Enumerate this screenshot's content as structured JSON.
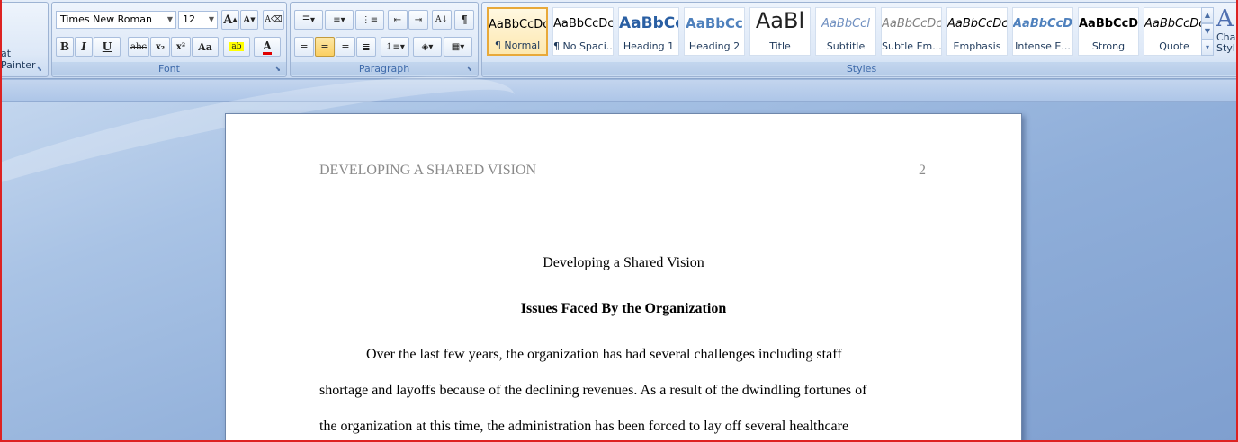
{
  "clipboard": {
    "format_painter_label": "at Painter"
  },
  "font": {
    "family": "Times New Roman",
    "size": "12",
    "group_label": "Font",
    "buttons": {
      "grow": "A",
      "shrink": "A",
      "bold": "B",
      "italic": "I",
      "underline": "U",
      "strike": "abc",
      "subscript": "x₂",
      "superscript": "x²",
      "change_case": "Aa",
      "highlight": "ab",
      "font_color": "A"
    }
  },
  "paragraph": {
    "group_label": "Paragraph"
  },
  "styles": {
    "group_label": "Styles",
    "items": [
      {
        "sample": "AaBbCcDc",
        "name": "¶ Normal"
      },
      {
        "sample": "AaBbCcDc",
        "name": "¶ No Spaci..."
      },
      {
        "sample": "AaBbCc",
        "name": "Heading 1"
      },
      {
        "sample": "AaBbCc",
        "name": "Heading 2"
      },
      {
        "sample": "AaBl",
        "name": "Title"
      },
      {
        "sample": "AaBbCcl",
        "name": "Subtitle"
      },
      {
        "sample": "AaBbCcDc",
        "name": "Subtle Em..."
      },
      {
        "sample": "AaBbCcDc",
        "name": "Emphasis"
      },
      {
        "sample": "AaBbCcDc",
        "name": "Intense E..."
      },
      {
        "sample": "AaBbCcDc",
        "name": "Strong"
      },
      {
        "sample": "AaBbCcDc",
        "name": "Quote"
      }
    ],
    "change_styles_label": "Cha Styl"
  },
  "document": {
    "running_head": "DEVELOPING A SHARED VISION",
    "page_number": "2",
    "title": "Developing a Shared Vision",
    "heading": "Issues Faced By the Organization",
    "lines": [
      "Over the last few years, the organization has had several challenges including staff",
      "shortage and layoffs because of the declining revenues. As a result of the dwindling fortunes of",
      "the organization at this time, the administration has been forced to lay off several healthcare"
    ]
  }
}
